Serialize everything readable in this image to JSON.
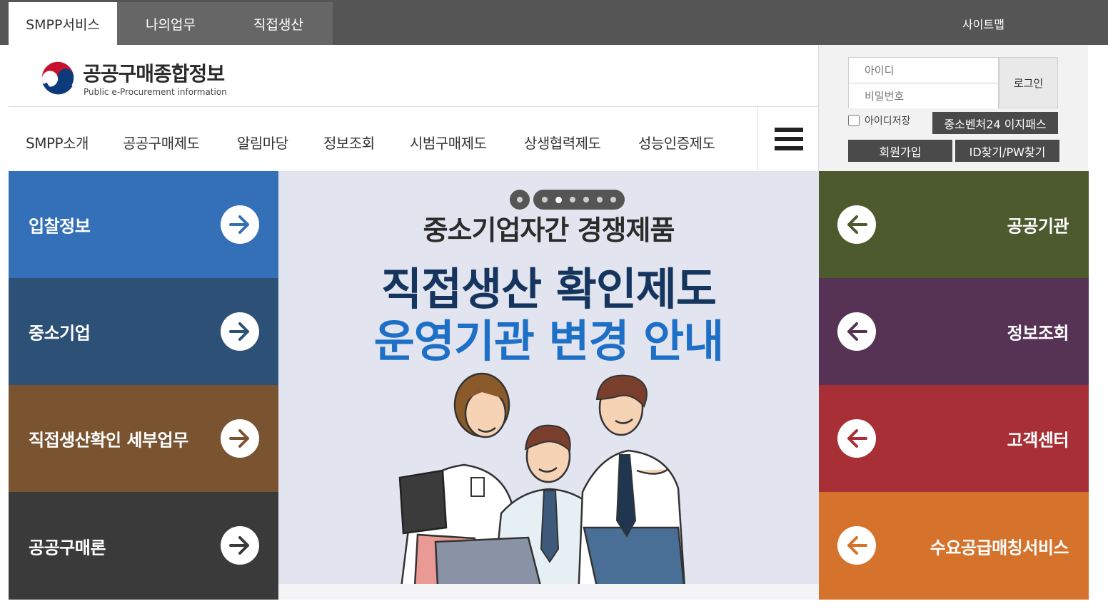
{
  "top_nav": {
    "tabs": [
      {
        "label": "SMPP서비스"
      },
      {
        "label": "나의업무"
      },
      {
        "label": "직접생산"
      }
    ],
    "sitemap_label": "사이트맵"
  },
  "header": {
    "logo_title": "공공구매종합정보",
    "logo_subtitle": "Public e-Procurement information",
    "menu": [
      {
        "label": "SMPP소개"
      },
      {
        "label": "공공구매제도"
      },
      {
        "label": "알림마당"
      },
      {
        "label": "정보조회"
      },
      {
        "label": "시범구매제도"
      },
      {
        "label": "상생협력제도"
      },
      {
        "label": "성능인증제도"
      }
    ],
    "menu_icon": "hamburger-icon"
  },
  "login": {
    "id_placeholder": "아이디",
    "pw_placeholder": "비밀번호",
    "login_label": "로그인",
    "save_id_label": "아이디저장",
    "easypass_label": "중소벤처24 이지패스",
    "join_label": "회원가입",
    "find_label": "ID찾기/PW찾기"
  },
  "left_tiles": [
    {
      "label": "입찰정보",
      "color": "#3470b8",
      "icon": "arrow-right-icon"
    },
    {
      "label": "중소기업",
      "color": "#2d5077",
      "icon": "arrow-right-icon"
    },
    {
      "label": "직접생산확인 세부업무",
      "color": "#7a5431",
      "icon": "arrow-right-icon"
    },
    {
      "label": "공공구매론",
      "color": "#3a3a3a",
      "icon": "arrow-right-icon"
    }
  ],
  "right_tiles": [
    {
      "label": "공공기관",
      "color": "#4d5a2e",
      "icon": "arrow-left-icon"
    },
    {
      "label": "정보조회",
      "color": "#563354",
      "icon": "arrow-left-icon"
    },
    {
      "label": "고객센터",
      "color": "#a72f35",
      "icon": "arrow-left-icon"
    },
    {
      "label": "수요공급매칭서비스",
      "color": "#d5722c",
      "icon": "arrow-left-icon"
    }
  ],
  "banner": {
    "line1": "중소기업자간 경쟁제품",
    "line2": "직접생산 확인제도",
    "line3": "운영기관 변경 안내",
    "slide_count": 6,
    "active_slide": 1
  },
  "colors": {
    "topbar": "#555555",
    "banner_bg": "#e2e5ef",
    "banner_title_dark": "#15355e",
    "banner_title_blue": "#1e6fc6"
  }
}
